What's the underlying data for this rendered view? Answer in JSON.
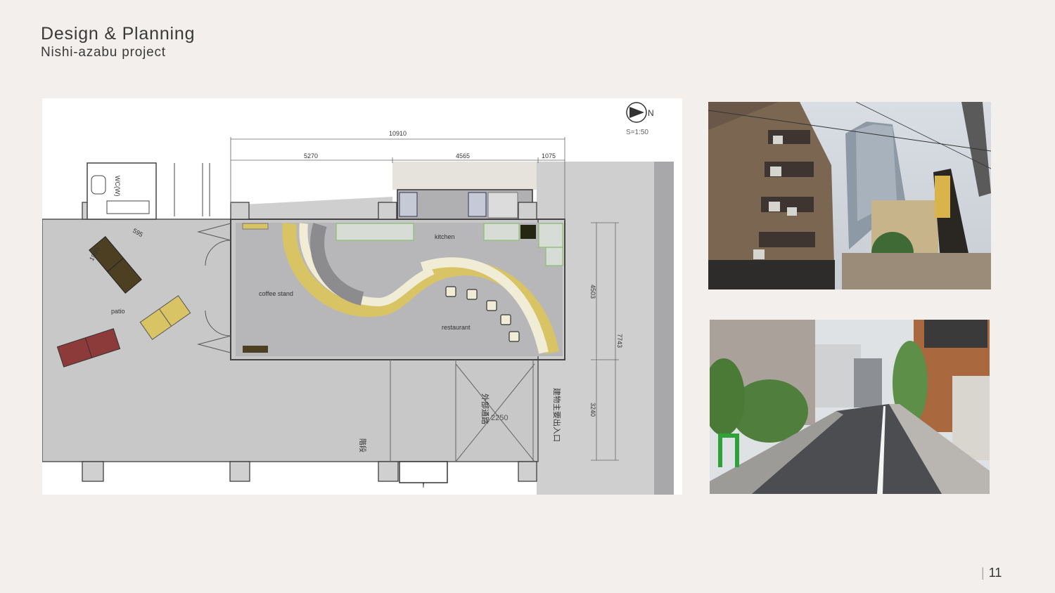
{
  "header": {
    "title": "Design & Planning",
    "subtitle": "Nishi-azabu project"
  },
  "plan": {
    "north_label": "N",
    "scale": "S=1:50",
    "dimensions": {
      "total_width": "10910",
      "seg_a": "5270",
      "seg_b": "4565",
      "seg_c": "1075",
      "depth_a": "4503",
      "depth_total": "7743",
      "depth_b": "3240",
      "bench_length": "1990",
      "bench_depth": "595",
      "passage_width": "2250"
    },
    "rooms": {
      "kitchen": "kitchen",
      "coffee_stand": "coffee stand",
      "restaurant": "restaurant",
      "patio": "patio",
      "wc": "WC(W)"
    },
    "jp_labels": {
      "outer_passage": "外部通路",
      "main_entrance": "建物主要出入口",
      "stair": "階段"
    },
    "colors": {
      "floor": "#b7b7b9",
      "exterior": "#cfcfd0",
      "yellow": "#d8c465",
      "cream": "#f1ecd6",
      "bench_dark": "#4d3f22",
      "bench_red": "#8c3a3a",
      "counter_green": "#92c27a"
    }
  },
  "photos": {
    "top": {
      "name": "street-view-tower"
    },
    "bottom": {
      "name": "street-view-alley"
    }
  },
  "footer": {
    "page_number": "11"
  }
}
